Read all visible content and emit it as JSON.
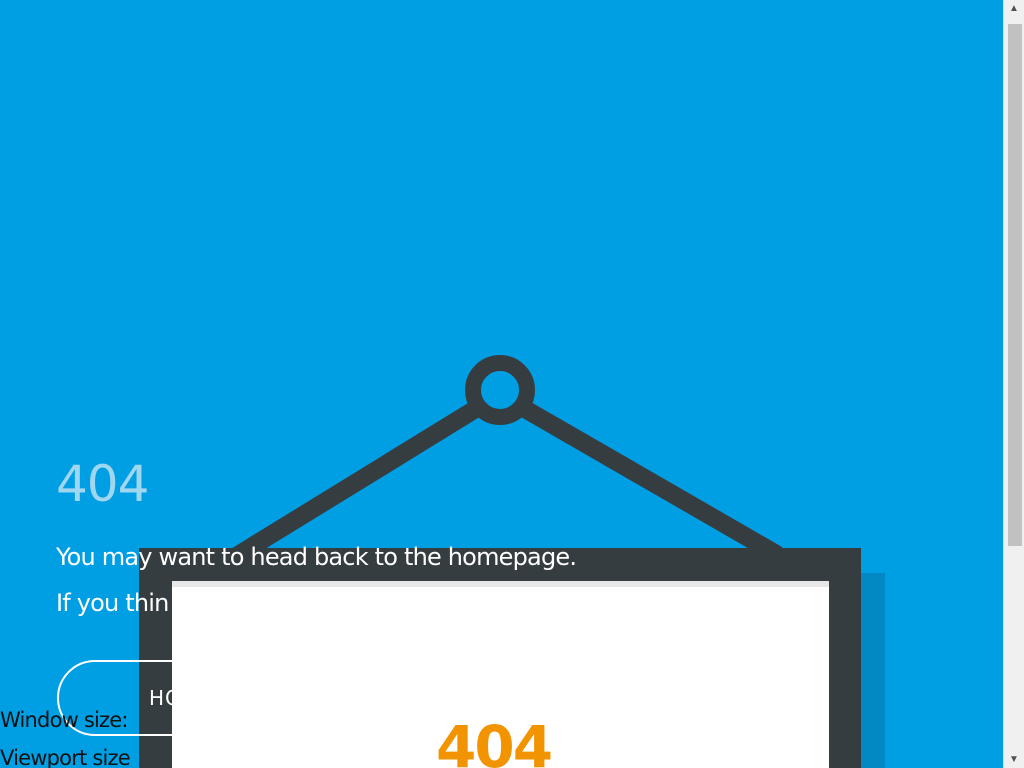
{
  "page": {
    "error_code": "404",
    "message_line1": "You may want to head back to the homepage.",
    "message_line2": "If you thin",
    "home_button_label": "HO",
    "sign_code": "404",
    "debug_window_label": "Window size:",
    "debug_viewport_label": "Viewport size"
  },
  "colors": {
    "background": "#009fe3",
    "frame": "#363d41",
    "sign_code": "#f29400",
    "error_code": "#9fd6f0"
  },
  "icons": {
    "scroll_up": "triangle-up",
    "scroll_down": "triangle-down"
  }
}
